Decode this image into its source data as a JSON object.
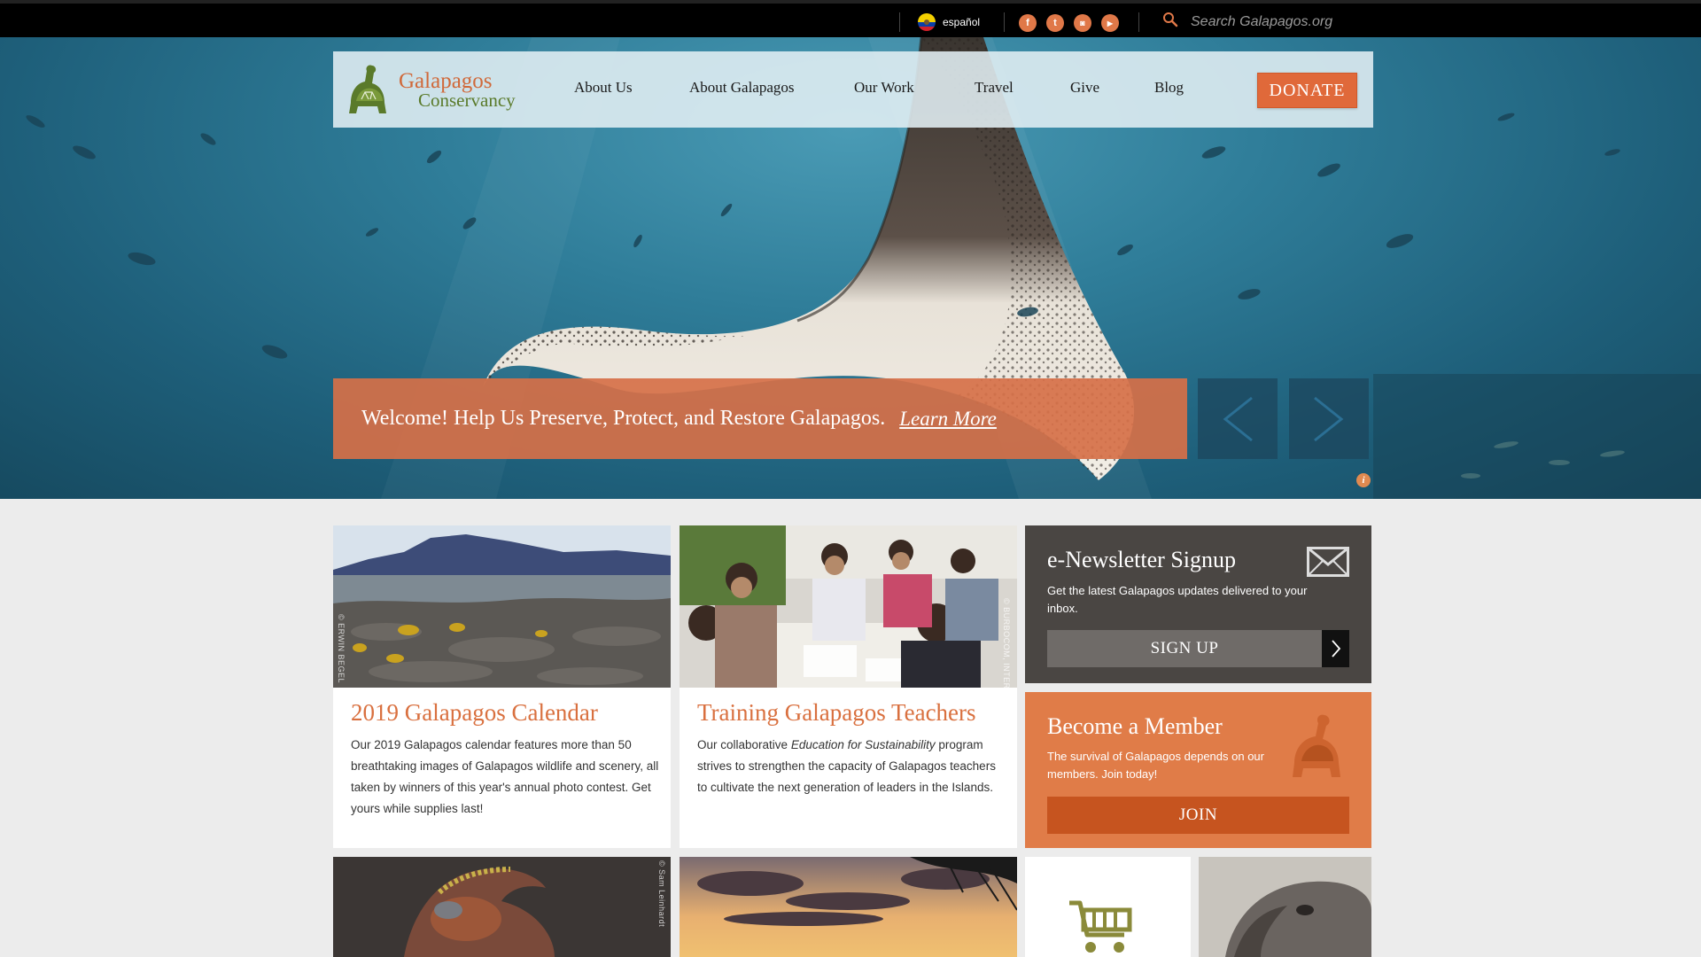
{
  "topbar": {
    "language": "español",
    "social": [
      {
        "icon": "facebook-icon",
        "glyph": "f"
      },
      {
        "icon": "twitter-icon",
        "glyph": "t"
      },
      {
        "icon": "instagram-icon",
        "glyph": "◙"
      },
      {
        "icon": "youtube-icon",
        "glyph": "▶"
      }
    ],
    "search_placeholder": "Search Galapagos.org"
  },
  "nav": {
    "logo_line1": "Galapagos",
    "logo_line2": "Conservancy",
    "links": [
      "About Us",
      "About Galapagos",
      "Our Work",
      "Travel",
      "Give",
      "Blog"
    ],
    "donate": "DONATE"
  },
  "hero": {
    "welcome": "Welcome! Help Us Preserve, Protect, and Restore Galapagos.",
    "learn_more": "Learn More",
    "info": "i"
  },
  "cards": [
    {
      "title": "2019 Galapagos Calendar",
      "credit": "© ERWIN BEGEL",
      "body": "Our 2019 Galapagos calendar features more than 50 breathtaking images of Galapagos wildlife and scenery, all taken by winners of this year's annual photo contest. Get yours while supplies last!"
    },
    {
      "title": "Training Galapagos Teachers",
      "credit": "© BURBOCOM, INTERIM",
      "body_pre": "Our collaborative ",
      "body_em": "Education for Sustainability",
      "body_post": " program strives to strengthen the capacity of Galapagos teachers to cultivate the next generation of leaders in the Islands."
    }
  ],
  "newsletter": {
    "title": "e-Newsletter Signup",
    "text": "Get the latest Galapagos updates delivered to your inbox.",
    "button": "SIGN UP"
  },
  "member": {
    "title": "Become a Member",
    "text": "The survival of Galapagos depends on our members. Join today!",
    "button": "JOIN"
  },
  "bottom": {
    "credit1": "© Sam Leinhardt"
  },
  "colors": {
    "accent": "#e07c48",
    "title_orange": "#d9703f",
    "dark_panel": "#4a4643",
    "join": "#c6541f"
  }
}
